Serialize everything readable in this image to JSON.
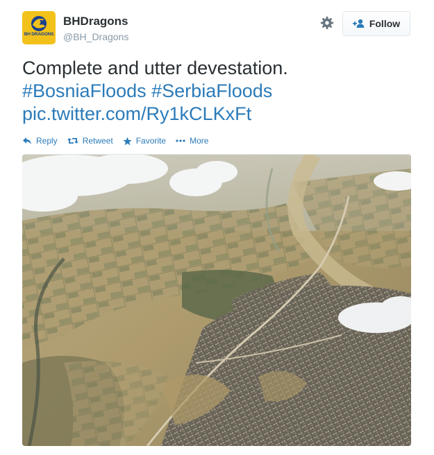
{
  "user": {
    "display_name": "BHDragons",
    "handle": "@BH_Dragons",
    "avatar_text": "BH DRAGONS",
    "avatar_color": "#f2c21a"
  },
  "header": {
    "settings_icon": "gear-icon",
    "follow_label": "Follow",
    "follow_icon": "add-user-icon"
  },
  "tweet": {
    "text": "Complete and utter devestation.",
    "hashtags": [
      "#BosniaFloods",
      "#SerbiaFloods"
    ],
    "link": "pic.twitter.com/Ry1kCLKxFt",
    "link_color": "#2b7bb9"
  },
  "actions": [
    {
      "label": "Reply",
      "icon": "reply-icon"
    },
    {
      "label": "Retweet",
      "icon": "retweet-icon"
    },
    {
      "label": "Favorite",
      "icon": "star-icon"
    },
    {
      "label": "More",
      "icon": "more-dots-icon"
    }
  ],
  "media": {
    "kind": "aerial photo of flooded town and farmland"
  }
}
